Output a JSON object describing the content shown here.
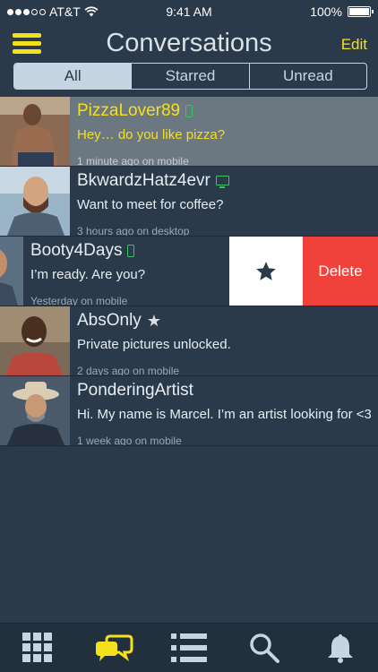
{
  "status_bar": {
    "carrier": "AT&T",
    "time": "9:41 AM",
    "battery": "100%"
  },
  "nav": {
    "title": "Conversations",
    "edit_label": "Edit"
  },
  "segments": [
    {
      "label": "All",
      "selected": true
    },
    {
      "label": "Starred",
      "selected": false
    },
    {
      "label": "Unread",
      "selected": false
    }
  ],
  "conversations": [
    {
      "name": "PizzaLover89",
      "message": "Hey… do you like pizza?",
      "meta": "1 minute ago on mobile",
      "device_icon": "phone-icon",
      "highlighted": true
    },
    {
      "name": "BkwardzHatz4evr",
      "message": "Want to meet for coffee?",
      "meta": "3 hours ago on desktop",
      "device_icon": "desktop-icon"
    },
    {
      "name": "Booty4Days",
      "message": "I’m ready. Are you?",
      "meta": "Yesterday on mobile",
      "device_icon": "phone-icon",
      "swiped": true
    },
    {
      "name": "AbsOnly",
      "message": "Private pictures unlocked.",
      "meta": "2 days ago on mobile",
      "badge_icon": "star-icon"
    },
    {
      "name": "PonderingArtist",
      "message": "Hi. My name is Marcel. I’m an artist looking for <3.",
      "meta": "1 week ago on mobile"
    }
  ],
  "swipe_actions": {
    "star_icon": "star-icon",
    "delete_label": "Delete"
  },
  "tabs": [
    {
      "icon": "grid-icon",
      "active": false
    },
    {
      "icon": "chat-bubbles-icon",
      "active": true
    },
    {
      "icon": "list-icon",
      "active": false
    },
    {
      "icon": "search-icon",
      "active": false
    },
    {
      "icon": "bell-icon",
      "active": false
    }
  ],
  "colors": {
    "background": "#2b3a4a",
    "accent": "#f5e01c",
    "online": "#34c759",
    "delete": "#f0423b",
    "segment": "#c5d6e2"
  }
}
